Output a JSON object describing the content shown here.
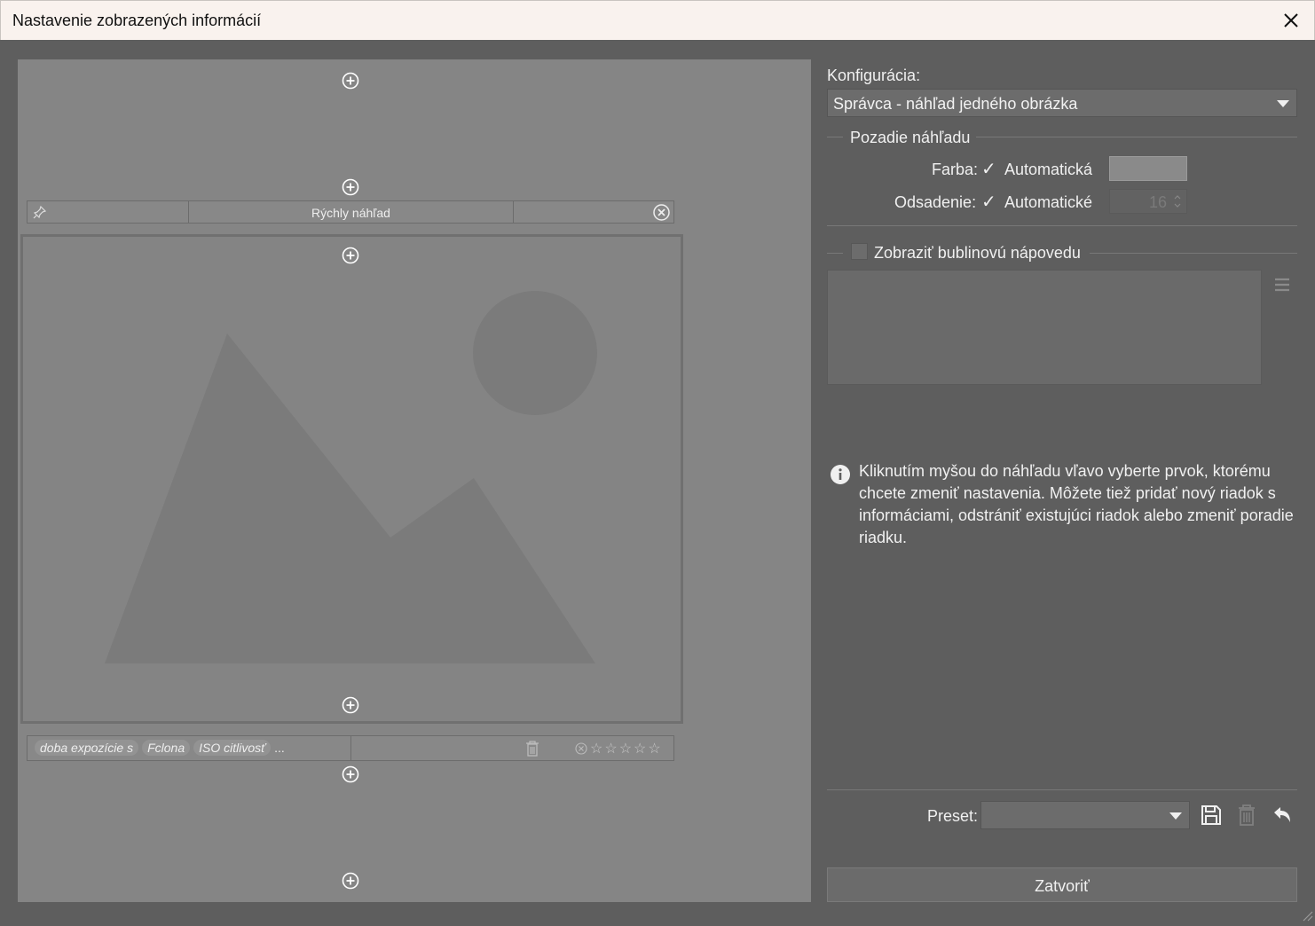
{
  "dialog": {
    "title": "Nastavenie zobrazených informácií"
  },
  "preview": {
    "header_bar": {
      "title": "Rýchly náhľad"
    },
    "footer_bar": {
      "chips": [
        "doba expozície s",
        "Fclona",
        "ISO citlivosť"
      ],
      "more": "...",
      "stars": "☆☆☆☆☆"
    }
  },
  "config": {
    "label": "Konfigurácia:",
    "selected": "Správca - náhľad jedného obrázka",
    "background_group": {
      "title": "Pozadie náhľadu",
      "color_label": "Farba:",
      "color_auto": "Automatická",
      "padding_label": "Odsadenie:",
      "padding_auto": "Automatické",
      "padding_value": "16",
      "swatch_color": "#8a8a8a"
    },
    "tooltip": {
      "label": "Zobraziť bublinovú nápovedu"
    },
    "info_text": "Kliknutím myšou do náhľadu vľavo vyberte prvok, ktorému chcete zmeniť nastavenia. Môžete tiež pridať nový riadok s informáciami, odstrániť existujúci riadok alebo zmeniť poradie riadku.",
    "preset": {
      "label": "Preset:",
      "value": ""
    },
    "close_button": "Zatvoriť"
  }
}
